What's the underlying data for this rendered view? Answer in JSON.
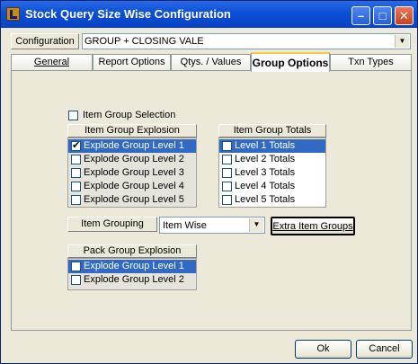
{
  "window": {
    "title": "Stock Query Size Wise Configuration",
    "minimize": "–",
    "maximize": "□",
    "close": "✕"
  },
  "configuration": {
    "label": "Configuration",
    "value": "GROUP + CLOSING VALE"
  },
  "tabs": [
    "General",
    "Report Options",
    "Qtys. / Values",
    "Group Options",
    "Txn Types"
  ],
  "active_tab": "Group Options",
  "item_group_selection": {
    "label": "Item Group Selection",
    "checked": false
  },
  "item_group_explosion": {
    "title": "Item Group Explosion",
    "items": [
      {
        "label": "Explode Group Level 1",
        "checked": true,
        "selected": true
      },
      {
        "label": "Explode Group Level 2",
        "checked": false
      },
      {
        "label": "Explode Group Level 3",
        "checked": false
      },
      {
        "label": "Explode Group Level 4",
        "checked": false
      },
      {
        "label": "Explode Group Level 5",
        "checked": false
      }
    ]
  },
  "item_group_totals": {
    "title": "Item Group Totals",
    "items": [
      {
        "label": "Level 1 Totals",
        "checked": false,
        "selected": true
      },
      {
        "label": "Level 2 Totals",
        "checked": false
      },
      {
        "label": "Level 3 Totals",
        "checked": false
      },
      {
        "label": "Level 4 Totals",
        "checked": false
      },
      {
        "label": "Level 5 Totals",
        "checked": false
      }
    ]
  },
  "item_grouping": {
    "label": "Item Grouping",
    "value": "Item Wise",
    "extra_button": "Extra Item Groups"
  },
  "pack_group_explosion": {
    "title": "Pack Group Explosion",
    "items": [
      {
        "label": "Explode Group Level 1",
        "checked": false,
        "selected": true
      },
      {
        "label": "Explode Group Level 2",
        "checked": false
      }
    ]
  },
  "buttons": {
    "ok": "Ok",
    "cancel": "Cancel"
  },
  "colors": {
    "title_bar": "#0a4fd6",
    "selection": "#316ac5",
    "face": "#ece9d8"
  }
}
